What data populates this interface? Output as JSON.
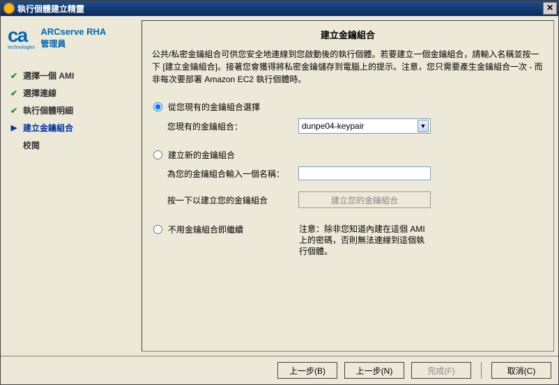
{
  "window": {
    "title": "執行個體建立精靈",
    "icon_name": "wizard-icon"
  },
  "brand": {
    "logo": "ca",
    "logo_sub": "technologies",
    "app_title": "ARCserve RHA",
    "app_sub": "管理員"
  },
  "steps": [
    {
      "label": "選擇一個 AMI",
      "state": "done"
    },
    {
      "label": "選擇連線",
      "state": "done"
    },
    {
      "label": "執行個體明細",
      "state": "done"
    },
    {
      "label": "建立金鑰組合",
      "state": "current"
    },
    {
      "label": "校閱",
      "state": "pending"
    }
  ],
  "content": {
    "title": "建立金鑰組合",
    "description": "公共/私密金鑰組合可供您安全地連線到您啟動後的執行個體。若要建立一個金鑰組合，請輸入名稱並按一下 [建立金鑰組合]。接著您會獲得將私密金鑰儲存到電腦上的提示。注意，您只需要產生金鑰組合一次 - 而非每次要部署 Amazon EC2 執行個體時。",
    "options": {
      "existing": {
        "radio_label": "從您現有的金鑰組合選擇",
        "field_label": "您現有的金鑰組合：",
        "selected_value": "dunpe04-keypair"
      },
      "create": {
        "radio_label": "建立新的金鑰組合",
        "name_field_label": "為您的金鑰組合輸入一個名稱：",
        "name_value": "",
        "button_hint": "按一下以建立您的金鑰組合",
        "button_label": "建立您的金鑰組合"
      },
      "none": {
        "radio_label": "不用金鑰組合即繼續",
        "note": "注意：除非您知道內建在這個 AMI 上的密碼，否則無法連線到這個執行個體。"
      }
    }
  },
  "footer": {
    "back": "上一步(B)",
    "next": "上一步(N)",
    "finish": "完成(F)",
    "cancel": "取消(C)"
  }
}
